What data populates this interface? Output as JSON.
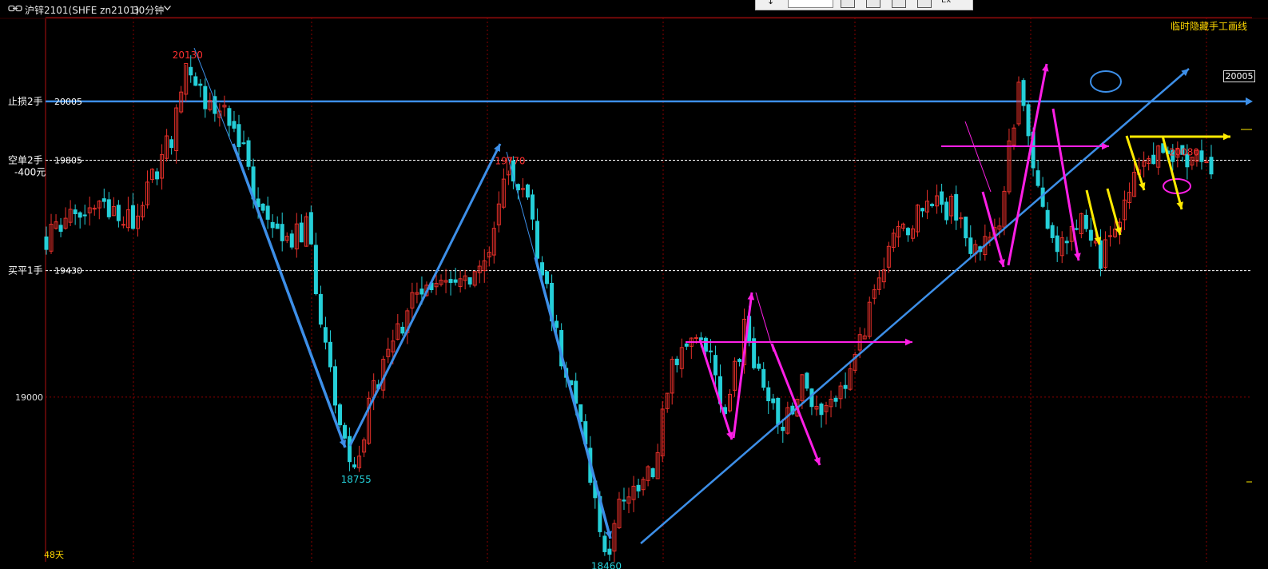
{
  "header": {
    "title": "沪锌2101(SHFE zn2101)",
    "period": "30分钟",
    "hide_drawings_label": "临时隐藏手工画线"
  },
  "toolpanel": {
    "ex_label": "Ex"
  },
  "colors": {
    "background": "#000000",
    "up_candle": "#e8302a",
    "down_candle": "#25cfd8",
    "trend_blue": "#3d8fe8",
    "magenta": "#ff1fe6",
    "yellow": "#ffea00",
    "grid": "#8a0000",
    "label_red": "#ff3030",
    "label_cyan": "#25cfd8",
    "label_yellow": "#ffd800"
  },
  "chart_data": {
    "type": "candlestick",
    "symbol": "zn2101",
    "period": "30分钟",
    "ylim": [
      18440,
      20290
    ],
    "y_ticks": [
      19000
    ],
    "levels": [
      {
        "price": 20005,
        "label": "止损2手",
        "value_label": "20005",
        "color": "#3d8fe8"
      },
      {
        "price": 19805,
        "label": "空单2手",
        "sub_label": "-400元",
        "value_label": "19805",
        "color": "#ffffff"
      },
      {
        "price": 19430,
        "label": "买平1手",
        "value_label": "19430",
        "color": "#ffffff"
      }
    ],
    "current_price_tag": "20005",
    "extrema": [
      {
        "label": "20130",
        "type": "high",
        "bar_index": 29
      },
      {
        "label": "18755",
        "type": "low",
        "bar_index": 64
      },
      {
        "label": "19770",
        "type": "high",
        "bar_index": 96
      },
      {
        "label": "18460",
        "type": "low",
        "bar_index": 116
      },
      {
        "label": "20080",
        "type": "high",
        "bar_index": 236
      }
    ],
    "bar_count": 243,
    "day_span_label": "48天",
    "waypoints": [
      [
        0,
        19530
      ],
      [
        4,
        19600
      ],
      [
        10,
        19660
      ],
      [
        18,
        19600
      ],
      [
        26,
        19880
      ],
      [
        29,
        20130
      ],
      [
        33,
        19990
      ],
      [
        39,
        19940
      ],
      [
        44,
        19650
      ],
      [
        49,
        19500
      ],
      [
        54,
        19580
      ],
      [
        60,
        19000
      ],
      [
        64,
        18755
      ],
      [
        68,
        19020
      ],
      [
        75,
        19300
      ],
      [
        82,
        19420
      ],
      [
        88,
        19400
      ],
      [
        93,
        19550
      ],
      [
        96,
        19770
      ],
      [
        100,
        19650
      ],
      [
        106,
        19200
      ],
      [
        111,
        18920
      ],
      [
        116,
        18460
      ],
      [
        120,
        18660
      ],
      [
        126,
        18740
      ],
      [
        130,
        19100
      ],
      [
        137,
        19200
      ],
      [
        141,
        18950
      ],
      [
        145,
        19220
      ],
      [
        149,
        19030
      ],
      [
        153,
        18890
      ],
      [
        157,
        19050
      ],
      [
        161,
        18920
      ],
      [
        165,
        19030
      ],
      [
        169,
        19200
      ],
      [
        173,
        19380
      ],
      [
        177,
        19560
      ],
      [
        183,
        19660
      ],
      [
        188,
        19640
      ],
      [
        193,
        19500
      ],
      [
        198,
        19620
      ],
      [
        202,
        20060
      ],
      [
        206,
        19680
      ],
      [
        211,
        19500
      ],
      [
        215,
        19650
      ],
      [
        219,
        19480
      ],
      [
        222,
        19560
      ],
      [
        226,
        19800
      ],
      [
        229,
        19770
      ],
      [
        233,
        19850
      ],
      [
        236,
        19800
      ],
      [
        240,
        19830
      ],
      [
        242,
        19760
      ]
    ]
  }
}
